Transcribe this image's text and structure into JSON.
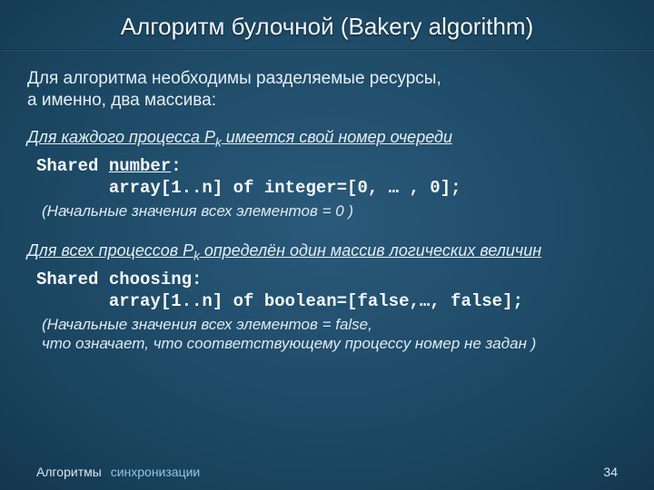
{
  "title": "Алгоритм булочной (Bakery algorithm)",
  "intro": "Для алгоритма необходимы разделяемые ресурсы,\n а именно, два массива:",
  "block1": {
    "heading_prefix": "Для каждого процесса P",
    "heading_sub": "k",
    "heading_suffix": " имеется свой номер очереди",
    "code_l1a": "Shared ",
    "code_l1b": "number",
    "code_l1c": ":",
    "code_l2": "       array[1..n] of integer=[0, … , 0];",
    "note": "(Начальные значения всех элементов  = 0 )"
  },
  "block2": {
    "heading_prefix": "Для всех процессов P",
    "heading_sub": "k",
    "heading_suffix": " определён один массив логических величин",
    "code_l1": "Shared choosing:",
    "code_l2": "       array[1..n] of boolean=[false,…, false];",
    "note": "(Начальные значения всех элементов  = false,\n что означает, что соответствующему процессу номер не задан )"
  },
  "footer": {
    "left_a": "Алгоритмы",
    "left_b": "синхронизации",
    "page": "34"
  }
}
